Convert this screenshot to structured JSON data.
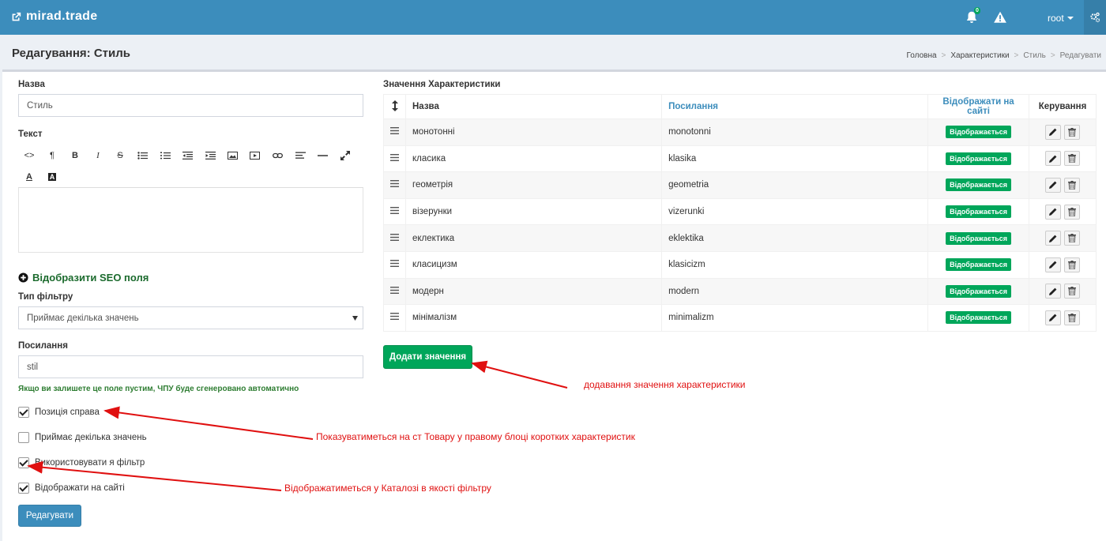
{
  "header": {
    "brand": "mirad.trade",
    "notifications_count": "0",
    "user": "root"
  },
  "page": {
    "title": "Редагування: Стиль"
  },
  "breadcrumb": [
    "Головна",
    "Характеристики",
    "Стиль",
    "Редагувати"
  ],
  "form": {
    "name_label": "Назва",
    "name_value": "Стиль",
    "text_label": "Текст",
    "seo_link": "Відобразити SEO поля",
    "filter_type_label": "Тип фільтру",
    "filter_type_value": "Приймає декілька значень",
    "link_label": "Посилання",
    "link_value": "stil",
    "link_hint": "Якщо ви залишете це поле пустим, ЧПУ буде сгенеровано автоматично",
    "checkboxes": [
      {
        "label": "Позиція справа",
        "checked": true
      },
      {
        "label": "Приймає декілька значень",
        "checked": false
      },
      {
        "label": "Використовувати я фільтр",
        "checked": true
      },
      {
        "label": "Відображати на сайті",
        "checked": true
      }
    ],
    "submit_label": "Редагувати"
  },
  "values_section": {
    "title": "Значення Характеристики",
    "columns": {
      "name": "Назва",
      "link": "Посилання",
      "show": "Відображати на сайті",
      "ctrl": "Керування"
    },
    "rows": [
      {
        "name": "монотонні",
        "link": "monotonni",
        "status": "Відображається"
      },
      {
        "name": "класика",
        "link": "klasika",
        "status": "Відображається"
      },
      {
        "name": "геометрія",
        "link": "geometria",
        "status": "Відображається"
      },
      {
        "name": "візерунки",
        "link": "vizerunki",
        "status": "Відображається"
      },
      {
        "name": "еклектика",
        "link": "eklektika",
        "status": "Відображається"
      },
      {
        "name": "класицизм",
        "link": "klasicizm",
        "status": "Відображається"
      },
      {
        "name": "модерн",
        "link": "modern",
        "status": "Відображається"
      },
      {
        "name": "мінімалізм",
        "link": "minimalizm",
        "status": "Відображається"
      }
    ],
    "add_button": "Додати значення"
  },
  "annotations": {
    "add_value": "додавання значення характеристики",
    "position_right": "Показуватиметься на ст Товару у правому блоці коротких характеристик",
    "filter": "Відображатиметься у Каталозі в якості фільтру"
  }
}
